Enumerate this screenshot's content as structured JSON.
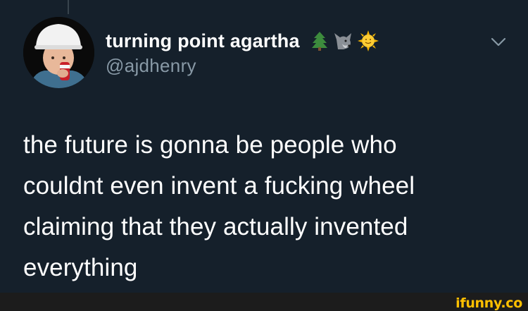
{
  "tweet": {
    "display_name": "turning point agartha",
    "handle": "@ajdhenry",
    "name_emojis": [
      "tree-emoji",
      "wolf-emoji",
      "sun-with-face-emoji"
    ],
    "text": "the future is gonna be people who\ncouldnt even invent a fucking wheel\nclaiming that they actually invented\neverything"
  },
  "watermark": {
    "label": "ifunny.co"
  },
  "colors": {
    "background": "#15202b",
    "primary_text": "#ffffff",
    "secondary_text": "#8899a6",
    "watermark": "#ffc000"
  }
}
